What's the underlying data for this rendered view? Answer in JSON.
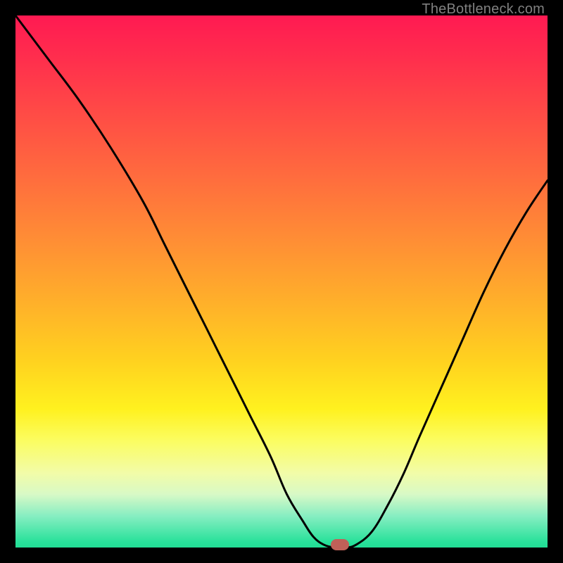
{
  "watermark": "TheBottleneck.com",
  "colors": {
    "frame": "#000000",
    "gradient_top": "#ff1a52",
    "gradient_bottom": "#22dd95",
    "curve": "#000000",
    "marker": "#c06058",
    "watermark_text": "#808080"
  },
  "chart_data": {
    "type": "line",
    "title": "",
    "xlabel": "",
    "ylabel": "",
    "xlim": [
      0,
      100
    ],
    "ylim": [
      0,
      100
    ],
    "x": [
      0,
      6,
      12,
      18,
      24,
      28,
      32,
      36,
      40,
      44,
      48,
      51,
      54,
      56,
      58,
      60,
      62,
      64,
      67,
      70,
      73,
      76,
      80,
      84,
      88,
      92,
      96,
      100
    ],
    "values": [
      100,
      92,
      84,
      75,
      65,
      57,
      49,
      41,
      33,
      25,
      17,
      10,
      5,
      2,
      0.5,
      0,
      0,
      0.5,
      3,
      8,
      14,
      21,
      30,
      39,
      48,
      56,
      63,
      69
    ],
    "marker": {
      "x": 61,
      "y": 0
    },
    "note": "x is relative horizontal position (0=left,100=right); values are relative vertical height from bottom (0=bottom,100=top). Curve is a V-shaped bottleneck profile with minimum around x≈58–62."
  }
}
